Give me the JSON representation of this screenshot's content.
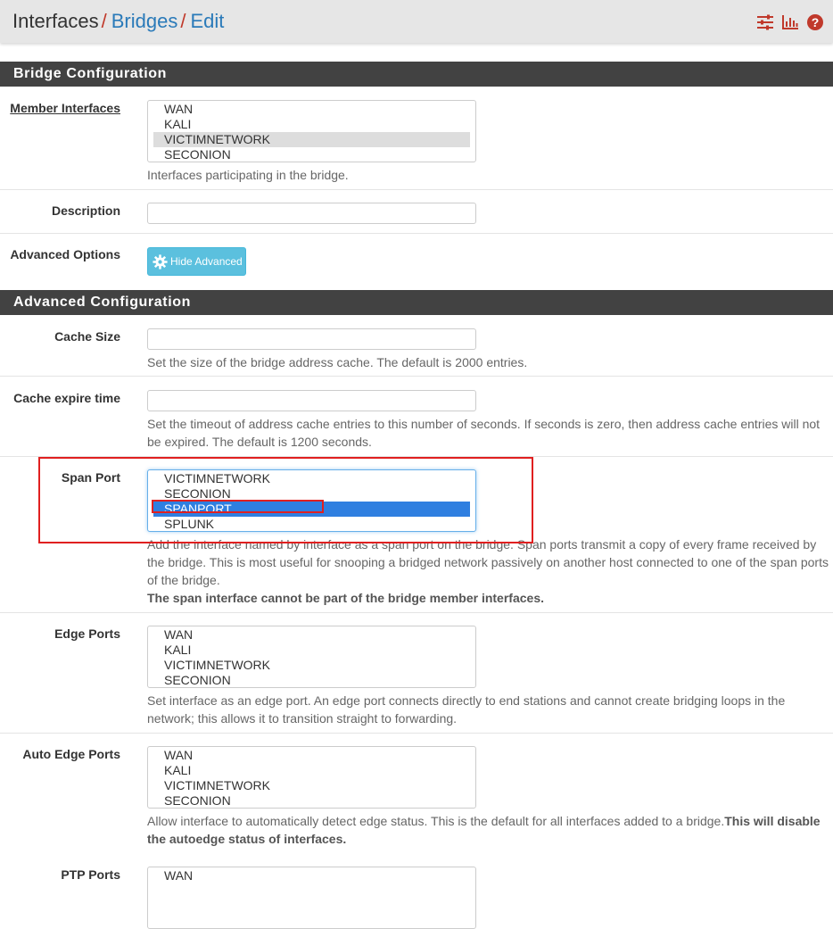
{
  "breadcrumb": {
    "items": [
      "Interfaces",
      "Bridges",
      "Edit"
    ],
    "separator": "/"
  },
  "header_icons": [
    "sliders-icon",
    "bar-chart-icon",
    "help-icon"
  ],
  "colors": {
    "accent_red": "#c0392b",
    "link_blue": "#2a7ab9",
    "panel_head_bg": "#424242",
    "btn_info": "#5bc0de",
    "select_blue": "#2f7fe0"
  },
  "bridge_config": {
    "title": "Bridge Configuration",
    "member_interfaces": {
      "label": "Member Interfaces",
      "options": [
        "WAN",
        "KALI",
        "VICTIMNETWORK",
        "SECONION"
      ],
      "selected": "VICTIMNETWORK",
      "help": "Interfaces participating in the bridge."
    },
    "description": {
      "label": "Description",
      "value": ""
    },
    "advanced_options": {
      "label": "Advanced Options",
      "button": "Hide Advanced"
    }
  },
  "advanced_config": {
    "title": "Advanced Configuration",
    "cache_size": {
      "label": "Cache Size",
      "value": "",
      "help": "Set the size of the bridge address cache. The default is 2000 entries."
    },
    "cache_expire": {
      "label": "Cache expire time",
      "value": "",
      "help_line1": "Set the timeout of address cache entries to this number of seconds. If seconds is zero, then address cache entries will not",
      "help_line2": "be expired. The default is 1200 seconds."
    },
    "span_port": {
      "label": "Span Port",
      "options": [
        "VICTIMNETWORK",
        "SECONION",
        "SPANPORT",
        "SPLUNK"
      ],
      "selected": "SPANPORT",
      "help_line1": "Add the interface named by interface as a span port on the bridge. Span ports transmit a copy of every frame received by",
      "help_line2": "the bridge. This is most useful for snooping a bridged network passively on another host connected to one of the span ports",
      "help_line3": "of the bridge.",
      "help_bold": "The span interface cannot be part of the bridge member interfaces."
    },
    "edge_ports": {
      "label": "Edge Ports",
      "options": [
        "WAN",
        "KALI",
        "VICTIMNETWORK",
        "SECONION"
      ],
      "help_line1": "Set interface as an edge port. An edge port connects directly to end stations and cannot create bridging loops in the",
      "help_line2": "network; this allows it to transition straight to forwarding."
    },
    "auto_edge_ports": {
      "label": "Auto Edge Ports",
      "options": [
        "WAN",
        "KALI",
        "VICTIMNETWORK",
        "SECONION"
      ],
      "help_line1": "Allow interface to automatically detect edge status. This is the default for all interfaces added to a bridge.",
      "help_line1_bold": "This will disable",
      "help_line2_bold": "the autoedge status of interfaces."
    },
    "ptp_ports": {
      "label": "PTP Ports",
      "options": [
        "WAN"
      ]
    }
  }
}
